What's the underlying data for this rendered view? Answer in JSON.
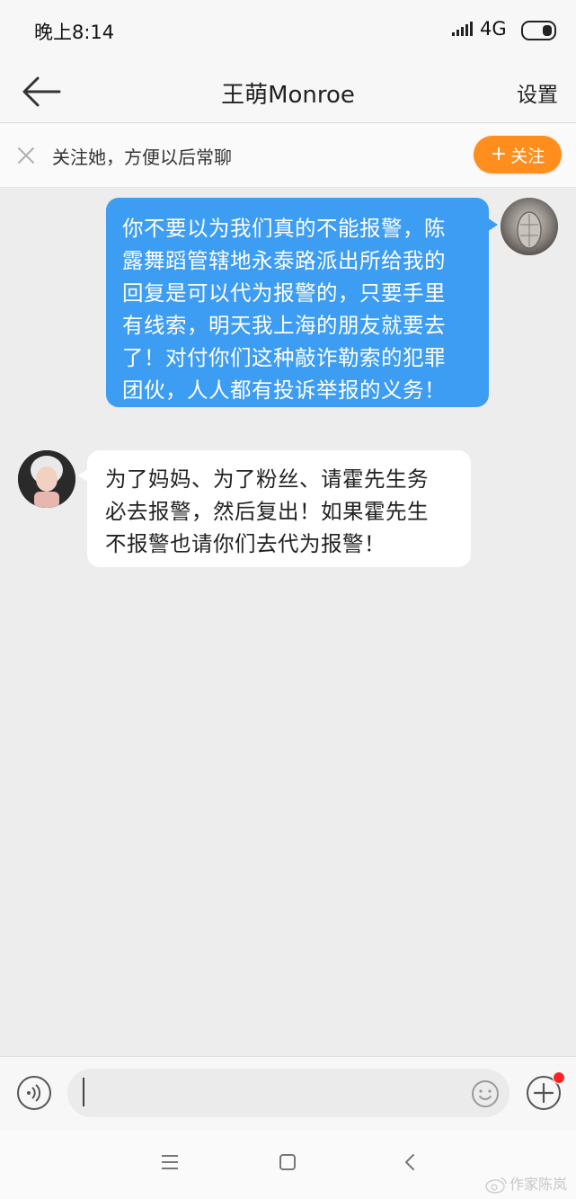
{
  "status_bar": {
    "time": "晚上8:14",
    "network": "4G",
    "icons": [
      "signal-icon",
      "battery-icon"
    ]
  },
  "nav": {
    "back_icon": "arrow-left-icon",
    "title": "王萌Monroe",
    "settings_label": "设置"
  },
  "follow_bar": {
    "close_icon": "close-icon",
    "hint": "关注她，方便以后常聊",
    "button_label": "关注",
    "button_color": "#ff8e1e"
  },
  "messages": [
    {
      "direction": "outgoing",
      "lines": [
        "你不要以为我们真的不能报警，陈",
        "露舞蹈管辖地永泰路派出所给我的",
        "回复是可以代为报警的，只要手里",
        "有线索，明天我上海的朋友就要去",
        "了！对付你们这种敲诈勒索的犯罪",
        "团伙，人人都有投诉举报的义务！"
      ],
      "bubble_color": "#3d9df2"
    },
    {
      "direction": "incoming",
      "lines": [
        "为了妈妈、为了粉丝、请霍先生务",
        "必去报警，然后复出！如果霍先生",
        "不报警也请你们去代为报警！"
      ],
      "bubble_color": "#ffffff"
    }
  ],
  "input_bar": {
    "value": "",
    "placeholder": "",
    "icons": [
      "voice-icon",
      "emoji-icon",
      "plus-icon"
    ]
  },
  "system_nav": {
    "icons": [
      "menu-icon",
      "home-icon",
      "back-icon"
    ]
  },
  "watermark": "作家陈岚"
}
